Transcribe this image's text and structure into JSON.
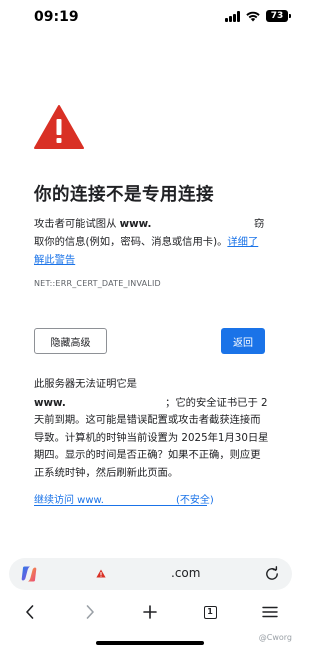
{
  "status_bar": {
    "time": "09:19",
    "battery": "73"
  },
  "warning": {
    "title": "你的连接不是专用连接",
    "intro_prefix": "攻击者可能试图从",
    "intro_site": "www.",
    "intro_suffix": "窃取你的信息(例如，密码、消息或信用卡)。",
    "learn_more": "详细了解此警告",
    "error_code": "NET::ERR_CERT_DATE_INVALID"
  },
  "buttons": {
    "advanced": "隐藏高级",
    "back": "返回"
  },
  "details": {
    "prefix": "此服务器无法证明它是",
    "site": "www.",
    "suffix": "；它的安全证书已于 2 天前到期。这可能是错误配置或攻击者截获连接而导致。计算机的时钟当前设置为 2025年1月30日星期四。显示的时间是否正确？如果不正确，则应更正系统时钟，然后刷新此页面。",
    "proceed_prefix": "继续访问 www.",
    "proceed_suffix": "(不安全)"
  },
  "address_bar": {
    "url": ".com"
  },
  "toolbar": {
    "tabs": "1"
  },
  "watermark": "@Cworg",
  "colors": {
    "warning_red": "#d93025",
    "link_blue": "#1a73e8"
  },
  "icons": [
    "signal-icon",
    "wifi-icon",
    "battery-icon",
    "warning-triangle-icon",
    "copilot-icon",
    "reload-icon",
    "back-arrow-icon",
    "forward-arrow-icon",
    "new-tab-plus-icon",
    "tab-count-icon",
    "menu-icon"
  ]
}
